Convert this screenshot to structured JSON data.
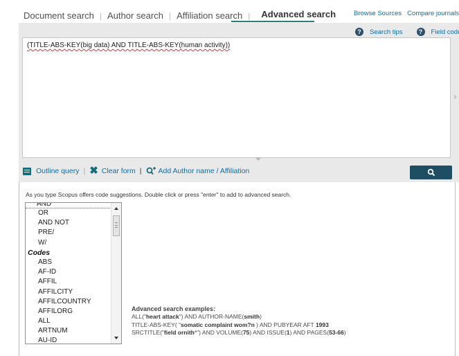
{
  "tabs": [
    {
      "label": "Document search",
      "active": false
    },
    {
      "label": "Author search",
      "active": false
    },
    {
      "label": "Affiliation search",
      "active": false
    },
    {
      "label": "Advanced search",
      "active": true
    }
  ],
  "top_links": {
    "browse_sources": "Browse Sources",
    "compare_journals": "Compare journals"
  },
  "help_links": {
    "search_tips": "Search tips",
    "field_codes": "Field codes"
  },
  "query": {
    "value": "(TITLE-ABS-KEY(big data) AND TITLE-ABS-KEY(human activity))"
  },
  "actions": {
    "outline_query": "Outline query",
    "clear_form": "Clear form",
    "add_author": "Add Author name / Affiliation"
  },
  "suggest": {
    "hint": "As you type Scopus offers code suggestions. Double click or press \"enter\" to add to advanced search.",
    "operators": [
      "AND",
      "OR",
      "AND NOT",
      "PRE/",
      "W/"
    ],
    "codes_header": "Codes",
    "codes": [
      "ABS",
      "AF-ID",
      "AFFIL",
      "AFFILCITY",
      "AFFILCOUNTRY",
      "AFFILORG",
      "ALL",
      "ARTNUM",
      "AU-ID"
    ]
  },
  "examples": {
    "title": "Advanced search examples:",
    "lines": [
      [
        {
          "t": "ALL(\"",
          "b": false
        },
        {
          "t": "heart attack",
          "b": true
        },
        {
          "t": "\") AND AUTHOR-NAME(",
          "b": false
        },
        {
          "t": "smith",
          "b": true
        },
        {
          "t": ")",
          "b": false
        }
      ],
      [
        {
          "t": "TITLE-ABS-KEY( \"",
          "b": false
        },
        {
          "t": "somatic complaint wom?n",
          "b": true
        },
        {
          "t": " ) AND PUBYEAR AFT ",
          "b": false
        },
        {
          "t": "1993",
          "b": true
        }
      ],
      [
        {
          "t": "SRCTITLE(\"",
          "b": false
        },
        {
          "t": "field ornith",
          "b": true
        },
        {
          "t": "*\") AND VOLUME(",
          "b": false
        },
        {
          "t": "75",
          "b": true
        },
        {
          "t": ") AND ISSUE(",
          "b": false
        },
        {
          "t": "1",
          "b": true
        },
        {
          "t": ") AND PAGES(",
          "b": false
        },
        {
          "t": "53-66",
          "b": true
        },
        {
          "t": ")",
          "b": false
        }
      ]
    ]
  },
  "colors": {
    "accent": "#2e7d7d",
    "link": "#0a6ea8",
    "search_button": "#1e4e64",
    "panel": "#e9e9e9"
  }
}
